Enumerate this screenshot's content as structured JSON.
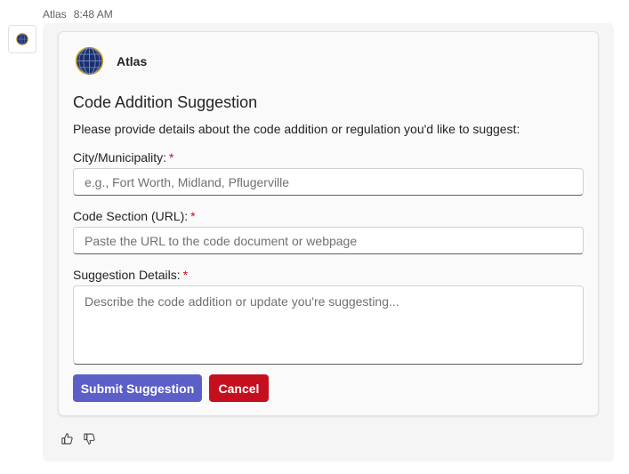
{
  "message": {
    "sender": "Atlas",
    "time": "8:48 AM"
  },
  "card": {
    "bot_name": "Atlas",
    "title": "Code Addition Suggestion",
    "intro": "Please provide details about the code addition or regulation you'd like to suggest:",
    "fields": [
      {
        "label": "City/Municipality:",
        "required_marker": "*",
        "placeholder": "e.g., Fort Worth, Midland, Pflugerville",
        "value": ""
      },
      {
        "label": "Code Section (URL):",
        "required_marker": "*",
        "placeholder": "Paste the URL to the code document or webpage",
        "value": ""
      },
      {
        "label": "Suggestion Details:",
        "required_marker": "*",
        "placeholder": "Describe the code addition or update you're suggesting...",
        "value": ""
      }
    ],
    "submit_label": "Submit Suggestion",
    "cancel_label": "Cancel"
  },
  "colors": {
    "primary": "#5b5fc7",
    "danger": "#c50f1f",
    "globe_blue": "#1b2f6b",
    "globe_gold": "#d4a21a"
  },
  "icons": [
    "globe-logo-icon",
    "thumbs-up-icon",
    "thumbs-down-icon"
  ]
}
